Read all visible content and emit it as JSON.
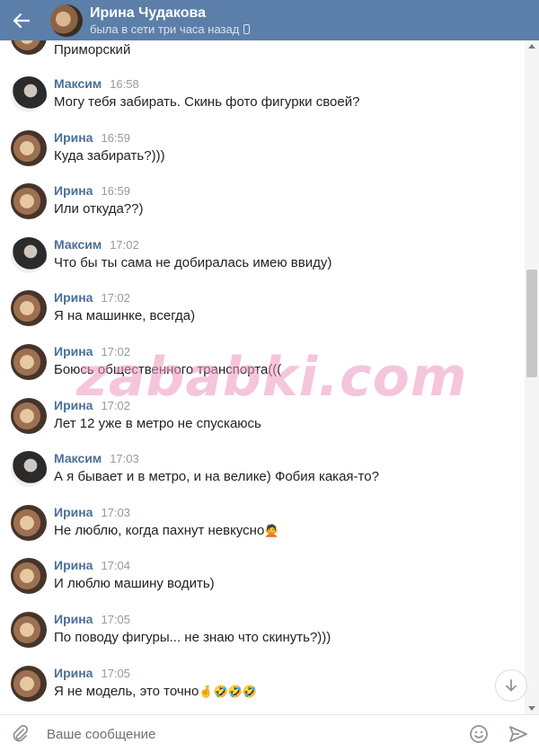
{
  "header": {
    "title": "Ирина Чудакова",
    "status": "была в сети три часа назад"
  },
  "first_line": "Приморский",
  "messages": [
    {
      "sender": "Максим",
      "time": "16:58",
      "text": "Могу тебя забирать. Скинь фото фигурки своей?",
      "emoji": "",
      "avatar": "maxim"
    },
    {
      "sender": "Ирина",
      "time": "16:59",
      "text": "Куда забирать?)))",
      "emoji": "",
      "avatar": "irina"
    },
    {
      "sender": "Ирина",
      "time": "16:59",
      "text": "Или откуда??)",
      "emoji": "",
      "avatar": "irina"
    },
    {
      "sender": "Максим",
      "time": "17:02",
      "text": "Что бы ты сама не добиралась имею ввиду)",
      "emoji": "",
      "avatar": "maxim"
    },
    {
      "sender": "Ирина",
      "time": "17:02",
      "text": "Я на машинке, всегда)",
      "emoji": "",
      "avatar": "irina"
    },
    {
      "sender": "Ирина",
      "time": "17:02",
      "text": "Боюсь общественного транспорта(((",
      "emoji": "",
      "avatar": "irina"
    },
    {
      "sender": "Ирина",
      "time": "17:02",
      "text": "Лет 12 уже в метро не спускаюсь",
      "emoji": "",
      "avatar": "irina"
    },
    {
      "sender": "Максим",
      "time": "17:03",
      "text": "А я бывает и в метро, и на велике) Фобия какая-то?",
      "emoji": "",
      "avatar": "maxim"
    },
    {
      "sender": "Ирина",
      "time": "17:03",
      "text": "Не люблю, когда пахнут невкусно",
      "emoji": "🙅",
      "avatar": "irina"
    },
    {
      "sender": "Ирина",
      "time": "17:04",
      "text": "И люблю машину водить)",
      "emoji": "",
      "avatar": "irina"
    },
    {
      "sender": "Ирина",
      "time": "17:05",
      "text": "По поводу фигуры... не знаю что скинуть?)))",
      "emoji": "",
      "avatar": "irina"
    },
    {
      "sender": "Ирина",
      "time": "17:05",
      "text": "Я не модель, это точно",
      "emoji": "🤞🤣🤣🤣",
      "avatar": "irina"
    }
  ],
  "watermark": "zababki.com",
  "composer": {
    "placeholder": "Ваше сообщение"
  },
  "icons": {
    "back": "arrow-left-icon",
    "phone": "phone-icon",
    "attach": "paperclip-icon",
    "emoji": "smile-icon",
    "send": "send-icon",
    "scroll_down": "chevron-down-icon"
  },
  "colors": {
    "header_bg": "#5b7fa8",
    "sender_name": "#4a6f98",
    "timestamp": "#939aa3",
    "watermark": "#ec96be"
  }
}
